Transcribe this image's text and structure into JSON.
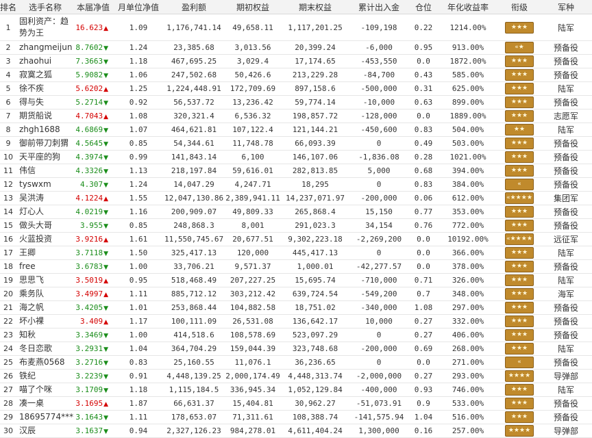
{
  "headers": [
    "排名",
    "选手名称",
    "本届净值",
    "月单位净值",
    "盈利额",
    "期初权益",
    "期末权益",
    "累计出入金",
    "仓位",
    "年化收益率",
    "衔级",
    "军种"
  ],
  "rows": [
    {
      "rank": "1",
      "name": "固利资产：趋势为王",
      "nav": "16.623",
      "dir": "up",
      "monthly": "1.09",
      "profit": "1,176,741.14",
      "start": "49,658.11",
      "end": "1,117,201.25",
      "flow": "-109,198",
      "position": "0.22",
      "annual": "1214.00%",
      "rank_badge": "★★★",
      "branch": "陆军"
    },
    {
      "rank": "2",
      "name": "zhangmeijun",
      "nav": "8.7602",
      "dir": "down",
      "monthly": "1.24",
      "profit": "23,385.68",
      "start": "3,013.56",
      "end": "20,399.24",
      "flow": "-6,000",
      "position": "0.95",
      "annual": "913.00%",
      "rank_badge": "«★",
      "branch": "预备役"
    },
    {
      "rank": "3",
      "name": "zhaohui",
      "nav": "7.3663",
      "dir": "down",
      "monthly": "1.18",
      "profit": "467,695.25",
      "start": "3,029.4",
      "end": "17,174.65",
      "flow": "-453,550",
      "position": "0.0",
      "annual": "1872.00%",
      "rank_badge": "★★★",
      "branch": "预备役"
    },
    {
      "rank": "4",
      "name": "寂寞之狐",
      "nav": "5.9082",
      "dir": "down",
      "monthly": "1.06",
      "profit": "247,502.68",
      "start": "50,426.6",
      "end": "213,229.28",
      "flow": "-84,700",
      "position": "0.43",
      "annual": "585.00%",
      "rank_badge": "★★★",
      "branch": "预备役"
    },
    {
      "rank": "5",
      "name": "徐不疾",
      "nav": "5.6202",
      "dir": "up",
      "monthly": "1.25",
      "profit": "1,224,448.91",
      "start": "172,709.69",
      "end": "897,158.6",
      "flow": "-500,000",
      "position": "0.31",
      "annual": "625.00%",
      "rank_badge": "★★★",
      "branch": "陆军"
    },
    {
      "rank": "6",
      "name": "得与失",
      "nav": "5.2714",
      "dir": "down",
      "monthly": "0.92",
      "profit": "56,537.72",
      "start": "13,236.42",
      "end": "59,774.14",
      "flow": "-10,000",
      "position": "0.63",
      "annual": "899.00%",
      "rank_badge": "★★★",
      "branch": "预备役"
    },
    {
      "rank": "7",
      "name": "期货船说",
      "nav": "4.7043",
      "dir": "up",
      "monthly": "1.08",
      "profit": "320,321.4",
      "start": "6,536.32",
      "end": "198,857.72",
      "flow": "-128,000",
      "position": "0.0",
      "annual": "1889.00%",
      "rank_badge": "★★★",
      "branch": "志愿军"
    },
    {
      "rank": "8",
      "name": "zhgh1688",
      "nav": "4.6869",
      "dir": "down",
      "monthly": "1.07",
      "profit": "464,621.81",
      "start": "107,122.4",
      "end": "121,144.21",
      "flow": "-450,600",
      "position": "0.83",
      "annual": "504.00%",
      "rank_badge": "★★",
      "branch": "陆军"
    },
    {
      "rank": "9",
      "name": "御前带刀刺猬",
      "nav": "4.5645",
      "dir": "down",
      "monthly": "0.85",
      "profit": "54,344.61",
      "start": "11,748.78",
      "end": "66,093.39",
      "flow": "0",
      "position": "0.49",
      "annual": "503.00%",
      "rank_badge": "★★★",
      "branch": "预备役"
    },
    {
      "rank": "10",
      "name": "天平座的狗",
      "nav": "4.3974",
      "dir": "down",
      "monthly": "0.99",
      "profit": "141,843.14",
      "start": "6,100",
      "end": "146,107.06",
      "flow": "-1,836.08",
      "position": "0.28",
      "annual": "1021.00%",
      "rank_badge": "★★★",
      "branch": "预备役"
    },
    {
      "rank": "11",
      "name": "伟信",
      "nav": "4.3326",
      "dir": "down",
      "monthly": "1.13",
      "profit": "218,197.84",
      "start": "59,616.01",
      "end": "282,813.85",
      "flow": "5,000",
      "position": "0.68",
      "annual": "394.00%",
      "rank_badge": "★★★",
      "branch": "预备役"
    },
    {
      "rank": "12",
      "name": "tyswxm",
      "nav": "4.307",
      "dir": "down",
      "monthly": "1.24",
      "profit": "14,047.29",
      "start": "4,247.71",
      "end": "18,295",
      "flow": "0",
      "position": "0.83",
      "annual": "384.00%",
      "rank_badge": "«",
      "branch": "预备役"
    },
    {
      "rank": "13",
      "name": "吴洪涛",
      "nav": "4.1224",
      "dir": "up",
      "monthly": "1.55",
      "profit": "12,047,130.86",
      "start": "2,389,941.11",
      "end": "14,237,071.97",
      "flow": "-200,000",
      "position": "0.06",
      "annual": "612.00%",
      "rank_badge": "«★★★★",
      "branch": "集团军"
    },
    {
      "rank": "14",
      "name": "灯心人",
      "nav": "4.0219",
      "dir": "down",
      "monthly": "1.16",
      "profit": "200,909.07",
      "start": "49,809.33",
      "end": "265,868.4",
      "flow": "15,150",
      "position": "0.77",
      "annual": "353.00%",
      "rank_badge": "★★★",
      "branch": "预备役"
    },
    {
      "rank": "15",
      "name": "做头大哥",
      "nav": "3.955",
      "dir": "down",
      "monthly": "0.85",
      "profit": "248,868.3",
      "start": "8,001",
      "end": "291,023.3",
      "flow": "34,154",
      "position": "0.76",
      "annual": "772.00%",
      "rank_badge": "★★★",
      "branch": "预备役"
    },
    {
      "rank": "16",
      "name": "火蓝投资",
      "nav": "3.9216",
      "dir": "up",
      "monthly": "1.61",
      "profit": "11,550,745.67",
      "start": "20,677.51",
      "end": "9,302,223.18",
      "flow": "-2,269,200",
      "position": "0.0",
      "annual": "10192.00%",
      "rank_badge": "«★★★★",
      "branch": "远征军"
    },
    {
      "rank": "17",
      "name": "王卿",
      "nav": "3.7118",
      "dir": "down",
      "monthly": "1.50",
      "profit": "325,417.13",
      "start": "120,000",
      "end": "445,417.13",
      "flow": "0",
      "position": "0.0",
      "annual": "366.00%",
      "rank_badge": "★★★",
      "branch": "陆军"
    },
    {
      "rank": "18",
      "name": "free",
      "nav": "3.6783",
      "dir": "down",
      "monthly": "1.00",
      "profit": "33,706.21",
      "start": "9,571.37",
      "end": "1,000.01",
      "flow": "-42,277.57",
      "position": "0.0",
      "annual": "378.00%",
      "rank_badge": "★★★",
      "branch": "预备役"
    },
    {
      "rank": "19",
      "name": "思思飞",
      "nav": "3.5019",
      "dir": "up",
      "monthly": "0.95",
      "profit": "518,468.49",
      "start": "207,227.25",
      "end": "15,695.74",
      "flow": "-710,000",
      "position": "0.71",
      "annual": "326.00%",
      "rank_badge": "★★★",
      "branch": "陆军"
    },
    {
      "rank": "20",
      "name": "乘务队",
      "nav": "3.4997",
      "dir": "up",
      "monthly": "1.11",
      "profit": "885,712.12",
      "start": "303,212.42",
      "end": "639,724.54",
      "flow": "-549,200",
      "position": "0.7",
      "annual": "348.00%",
      "rank_badge": "★★★",
      "branch": "海军"
    },
    {
      "rank": "21",
      "name": "海之帆",
      "nav": "3.4205",
      "dir": "down",
      "monthly": "1.01",
      "profit": "253,868.44",
      "start": "104,882.58",
      "end": "18,751.02",
      "flow": "-340,000",
      "position": "1.08",
      "annual": "297.00%",
      "rank_badge": "★★★",
      "branch": "预备役"
    },
    {
      "rank": "22",
      "name": "坏小裸",
      "nav": "3.409",
      "dir": "up",
      "monthly": "1.17",
      "profit": "100,111.09",
      "start": "26,531.08",
      "end": "136,642.17",
      "flow": "10,000",
      "position": "0.27",
      "annual": "332.00%",
      "rank_badge": "★★★",
      "branch": "预备役"
    },
    {
      "rank": "23",
      "name": "知秋",
      "nav": "3.3469",
      "dir": "down",
      "monthly": "1.00",
      "profit": "414,518.6",
      "start": "108,578.69",
      "end": "523,097.29",
      "flow": "0",
      "position": "0.27",
      "annual": "406.00%",
      "rank_badge": "★★★",
      "branch": "预备役"
    },
    {
      "rank": "24",
      "name": "冬日恋歌",
      "nav": "3.2931",
      "dir": "down",
      "monthly": "1.04",
      "profit": "364,704.29",
      "start": "159,044.39",
      "end": "323,748.68",
      "flow": "-200,000",
      "position": "0.69",
      "annual": "268.00%",
      "rank_badge": "★★★",
      "branch": "陆军"
    },
    {
      "rank": "25",
      "name": "布麦燕0568",
      "nav": "3.2716",
      "dir": "down",
      "monthly": "0.83",
      "profit": "25,160.55",
      "start": "11,076.1",
      "end": "36,236.65",
      "flow": "0",
      "position": "0.0",
      "annual": "271.00%",
      "rank_badge": "«",
      "branch": "预备役"
    },
    {
      "rank": "26",
      "name": "铁纪",
      "nav": "3.2239",
      "dir": "down",
      "monthly": "0.91",
      "profit": "4,448,139.25",
      "start": "2,000,174.49",
      "end": "4,448,313.74",
      "flow": "-2,000,000",
      "position": "0.27",
      "annual": "293.00%",
      "rank_badge": "★★★★",
      "branch": "导弹部"
    },
    {
      "rank": "27",
      "name": "喵了个咪",
      "nav": "3.1709",
      "dir": "down",
      "monthly": "1.18",
      "profit": "1,115,184.5",
      "start": "336,945.34",
      "end": "1,052,129.84",
      "flow": "-400,000",
      "position": "0.93",
      "annual": "746.00%",
      "rank_badge": "★★★",
      "branch": "陆军"
    },
    {
      "rank": "28",
      "name": "凑一桌",
      "nav": "3.1695",
      "dir": "up",
      "monthly": "1.87",
      "profit": "66,631.37",
      "start": "15,404.81",
      "end": "30,962.27",
      "flow": "-51,073.91",
      "position": "0.9",
      "annual": "533.00%",
      "rank_badge": "★★★",
      "branch": "预备役"
    },
    {
      "rank": "29",
      "name": "18695774***",
      "nav": "3.1643",
      "dir": "down",
      "monthly": "1.11",
      "profit": "178,653.07",
      "start": "71,311.61",
      "end": "108,388.74",
      "flow": "-141,575.94",
      "position": "1.04",
      "annual": "516.00%",
      "rank_badge": "★★★",
      "branch": "预备役"
    },
    {
      "rank": "30",
      "name": "汉辰",
      "nav": "3.1637",
      "dir": "down",
      "monthly": "0.94",
      "profit": "2,327,126.23",
      "start": "984,278.01",
      "end": "4,611,404.24",
      "flow": "1,300,000",
      "position": "0.16",
      "annual": "257.00%",
      "rank_badge": "★★★★",
      "branch": "导弹部"
    }
  ]
}
